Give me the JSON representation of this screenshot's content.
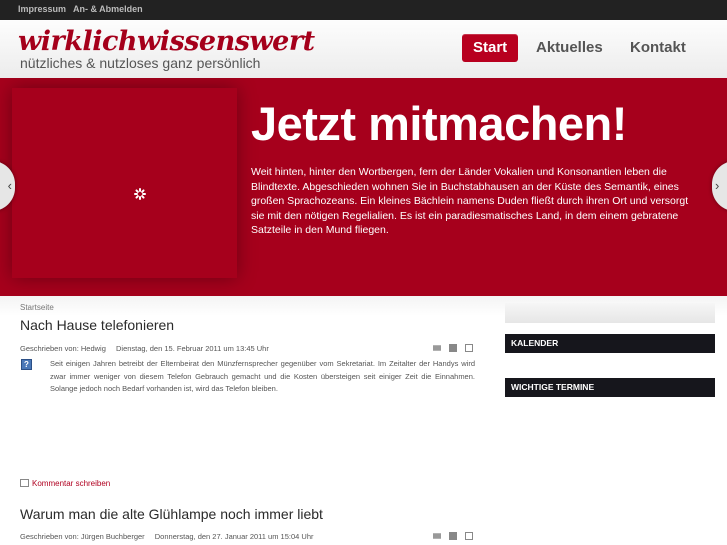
{
  "topbar": {
    "links": [
      "Impressum",
      "An- & Abmelden"
    ]
  },
  "header": {
    "logo": "wirklichwissenswert",
    "tagline": "nützliches & nutzloses ganz persönlich",
    "nav": [
      {
        "label": "Start",
        "active": true
      },
      {
        "label": "Aktuelles",
        "active": false
      },
      {
        "label": "Kontakt",
        "active": false
      }
    ]
  },
  "slider": {
    "heading": "Jetzt mitmachen!",
    "text": "Weit hinten, hinter den Wortbergen, fern der Länder Vokalien und Konsonantien leben die Blindtexte. Abgeschieden wohnen Sie in Buchstabhausen an der Küste des Semantik, eines großen Sprachozeans. Ein kleines Bächlein namens Duden fließt durch ihren Ort und versorgt sie mit den nötigen Regelialien. Es ist ein paradiesmatisches Land, in dem einem gebratene Satzteile in den Mund fliegen.",
    "prev_arrow": "‹",
    "next_arrow": "›",
    "accent": "#a6001c"
  },
  "breadcrumb": "Startseite",
  "articles": [
    {
      "title": "Nach Hause telefonieren",
      "author": "Geschrieben von: Hedwig",
      "date": "Dienstag, den 15. Februar 2011 um 13:45 Uhr",
      "body": "Seit einigen Jahren betreibt der Elternbeirat den Münzfernsprecher gegenüber vom Sekretariat. Im Zeitalter der Handys wird zwar immer weniger von diesem Telefon Gebrauch gemacht und die Kosten übersteigen seit einiger Zeit die Einnahmen. Solange jedoch noch Bedarf vorhanden ist, wird das Telefon bleiben.",
      "comment": "Kommentar schreiben"
    },
    {
      "title": "Warum man die alte Glühlampe noch immer liebt",
      "author": "Geschrieben von: Jürgen Buchberger",
      "date": "Donnerstag, den 27. Januar 2011 um 15:04 Uhr"
    }
  ],
  "sidebar": {
    "boxes": [
      "KALENDER",
      "WICHTIGE TERMINE"
    ]
  },
  "icons": {
    "email": "email-icon",
    "print": "print-icon",
    "pdf": "pdf-icon",
    "user": "user-icon",
    "comment": "comment-icon",
    "loading": "loading-spinner-icon"
  }
}
